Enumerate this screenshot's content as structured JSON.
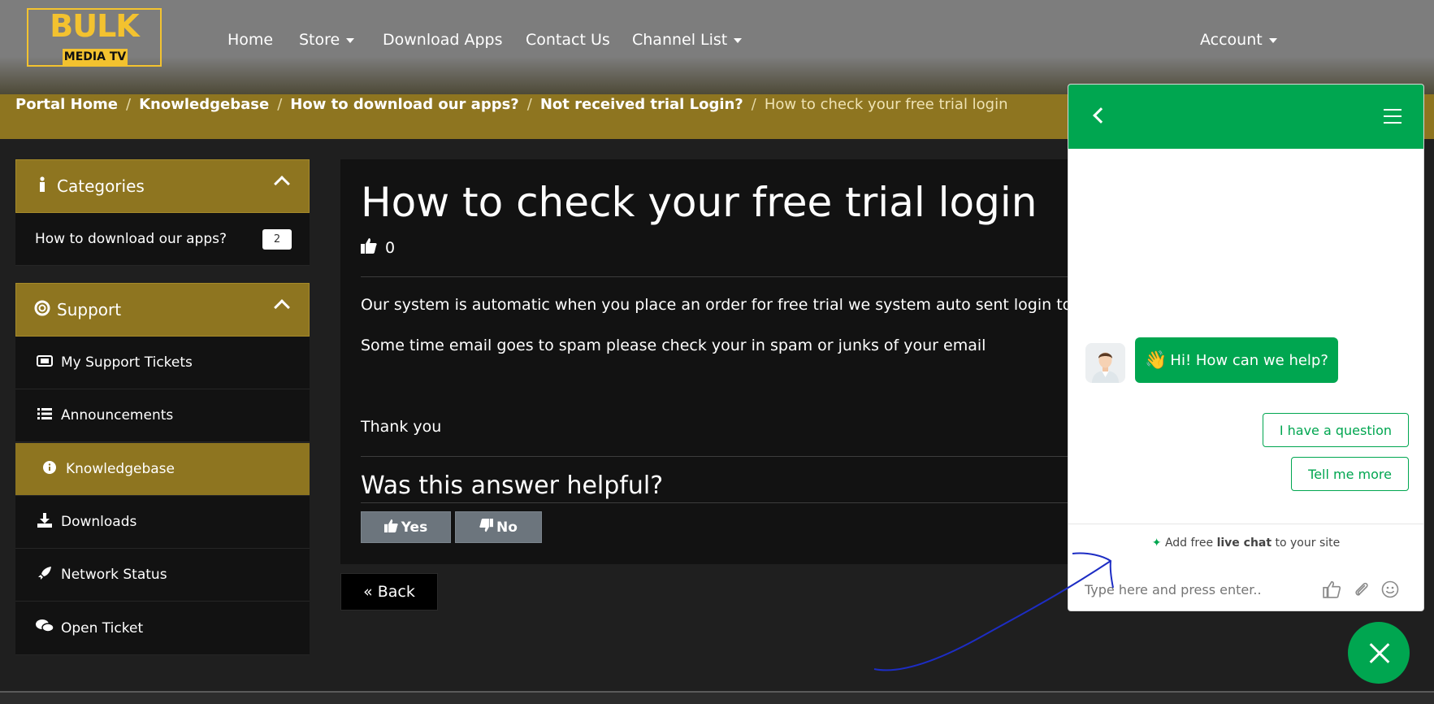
{
  "brand": {
    "name_top": "BULK",
    "name_bottom": "MEDIA TV"
  },
  "nav": {
    "home": "Home",
    "store": "Store",
    "download_apps": "Download Apps",
    "contact": "Contact Us",
    "channel_list": "Channel List",
    "account": "Account"
  },
  "breadcrumb": {
    "items": [
      "Portal Home",
      "Knowledgebase",
      "How to download our apps?",
      "Not received trial Login?"
    ],
    "current": "How to check your free trial login",
    "separator": "/"
  },
  "sidebar": {
    "categories": {
      "title": "Categories",
      "items": [
        {
          "label": "How to download our apps?",
          "count": "2"
        }
      ]
    },
    "support": {
      "title": "Support",
      "items": [
        {
          "label": "My Support Tickets",
          "icon": "ticket-icon"
        },
        {
          "label": "Announcements",
          "icon": "list-icon"
        },
        {
          "label": "Knowledgebase",
          "icon": "info-circle-icon",
          "active": true
        },
        {
          "label": "Downloads",
          "icon": "download-icon"
        },
        {
          "label": "Network Status",
          "icon": "rocket-icon"
        },
        {
          "label": "Open Ticket",
          "icon": "comments-icon"
        }
      ]
    }
  },
  "article": {
    "title": "How to check your free trial login",
    "likes": "0",
    "paragraphs": [
      "Our system is automatic when you place an order for free trial we system auto sent login to your",
      "Some time email goes to spam please check your in spam or junks of your email",
      "Thank you"
    ],
    "helpful_question": "Was this answer helpful?",
    "yes_label": "Yes",
    "no_label": "No",
    "back_label": "« Back"
  },
  "chat": {
    "greeting": "Hi! How can we help?",
    "greeting_emoji": "👋",
    "quick_replies": [
      "I have a question",
      "Tell me more"
    ],
    "powered_prefix": "Add free ",
    "powered_bold": "live chat",
    "powered_suffix": " to your site",
    "input_placeholder": "Type here and press enter..",
    "accent_color": "#00a650"
  },
  "colors": {
    "gold": "#8e7520",
    "dark": "#121212"
  }
}
